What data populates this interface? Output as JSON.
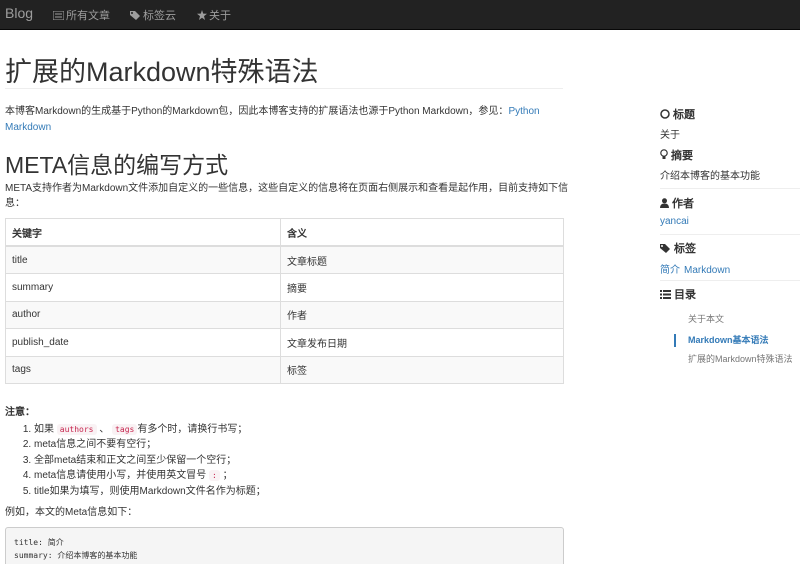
{
  "nav": {
    "brand": "Blog",
    "items": [
      {
        "label": "所有文章",
        "icon": "list-icon"
      },
      {
        "label": "标签云",
        "icon": "tags-icon"
      },
      {
        "label": "关于",
        "icon": "star-icon"
      }
    ]
  },
  "article": {
    "title": "扩展的Markdown特殊语法",
    "intro_text": "本博客Markdown的生成基于Python的Markdown包，因此本博客支持的扩展语法也源于Python Markdown，参见：",
    "intro_link": "Python Markdown",
    "section_title": "META信息的编写方式",
    "section_desc": "META支持作者为Markdown文件添加自定义的一些信息，这些自定义的信息将在页面右侧展示和查看是起作用，目前支持如下信息：",
    "table": {
      "headers": [
        "关键字",
        "含义"
      ],
      "rows": [
        [
          "title",
          "文章标题"
        ],
        [
          "summary",
          "摘要"
        ],
        [
          "author",
          "作者"
        ],
        [
          "publish_date",
          "文章发布日期"
        ],
        [
          "tags",
          "标签"
        ]
      ]
    },
    "note_label": "注意：",
    "notes": {
      "n1_pre": "如果",
      "n1_code1": "authors",
      "n1_mid": "、",
      "n1_code2": "tags",
      "n1_post": "有多个时，请换行书写；",
      "n2": "meta信息之间不要有空行；",
      "n3": "全部meta结束和正文之间至少保留一个空行；",
      "n4_pre": "meta信息请使用小写，并使用英文冒号",
      "n4_code": ":",
      "n4_post": "；",
      "n5": "title如果为填写，则使用Markdown文件名作为标题；"
    },
    "example_text": "例如，本文的Meta信息如下：",
    "code_lines": [
      "title: 简介",
      "summary: 介绍本博客的基本功能"
    ]
  },
  "sidebar": {
    "title_label": "标题",
    "title_value": "关于",
    "summary_label": "摘要",
    "summary_value": "介绍本博客的基本功能",
    "author_label": "作者",
    "author_value": "yancai",
    "tags_label": "标签",
    "tags": [
      "简介",
      "Markdown"
    ],
    "toc_label": "目录",
    "toc": [
      {
        "label": "关于本文",
        "active": false
      },
      {
        "label": "Markdown基本语法",
        "active": true
      },
      {
        "label": "扩展的Markdown特殊语法",
        "active": false
      }
    ]
  }
}
